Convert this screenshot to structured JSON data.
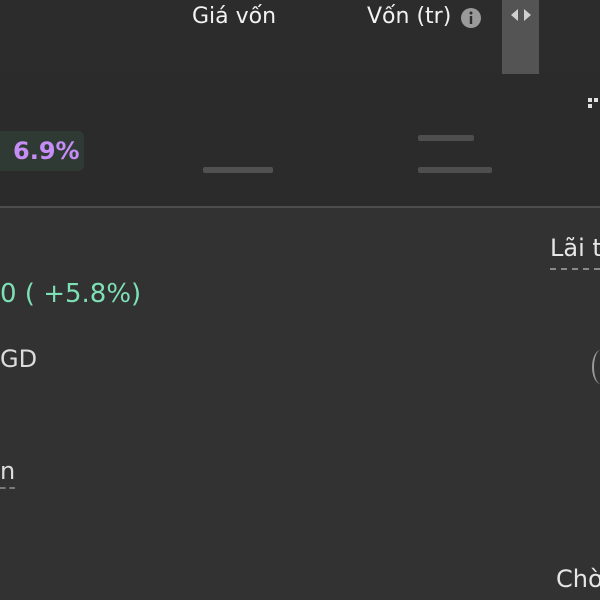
{
  "header": {
    "cost_price_label": "Giá vốn",
    "capital_label": "Vốn (tr)",
    "info_icon": "info-icon",
    "scroll_icon": "left-right-arrows-icon"
  },
  "row": {
    "percent": "6.9%",
    "percent_color": "#c58df5"
  },
  "detail": {
    "change": "0 ( +5.8%)",
    "change_color": "#7ee0b5",
    "gd_text": "GD",
    "n_text": "n",
    "profit_label": "Lãi t",
    "pending_label": "Chờ"
  }
}
